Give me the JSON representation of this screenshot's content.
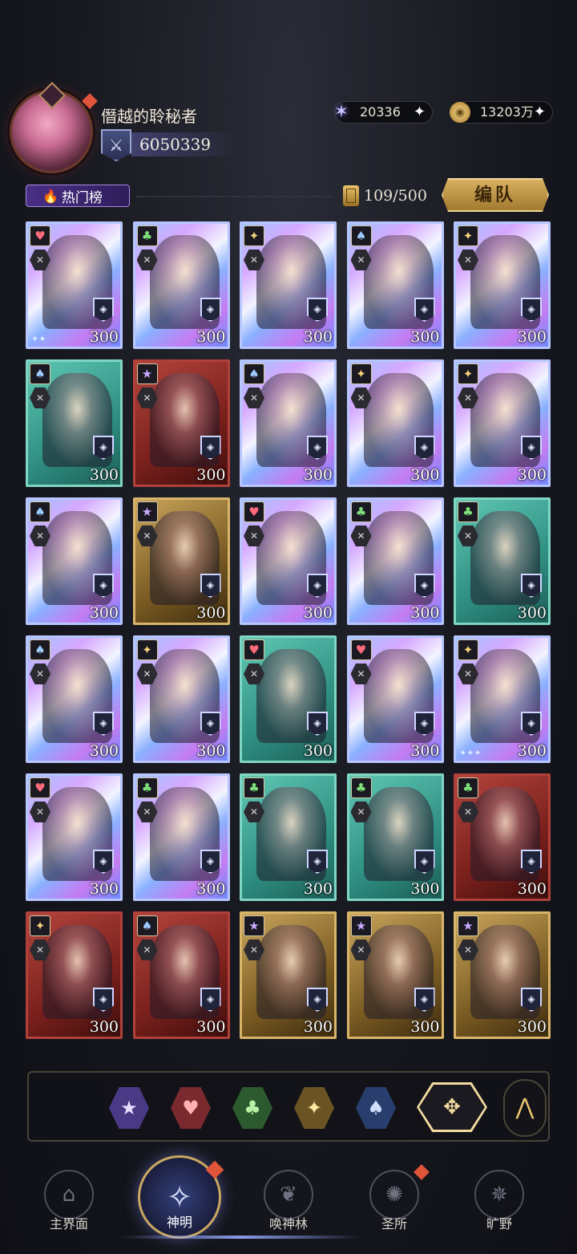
{
  "player": {
    "name": "僭越的聆秘者",
    "power": "6050339"
  },
  "currencies": {
    "star": "20336",
    "gold": "13203万"
  },
  "toolbar": {
    "hot_list_label": "热门榜",
    "capacity": "109/500",
    "formation_label": "编队"
  },
  "cards": [
    {
      "frame": "holo",
      "suit": "heart",
      "level": "300",
      "stars": "✦✦"
    },
    {
      "frame": "holo",
      "suit": "club",
      "level": "300",
      "stars": ""
    },
    {
      "frame": "holo",
      "suit": "spark",
      "level": "300",
      "stars": ""
    },
    {
      "frame": "holo",
      "suit": "spade",
      "level": "300",
      "stars": ""
    },
    {
      "frame": "holo",
      "suit": "spark",
      "level": "300",
      "stars": ""
    },
    {
      "frame": "teal",
      "suit": "spade",
      "level": "300",
      "stars": ""
    },
    {
      "frame": "red",
      "suit": "star",
      "level": "300",
      "stars": ""
    },
    {
      "frame": "holo",
      "suit": "spade",
      "level": "300",
      "stars": ""
    },
    {
      "frame": "holo",
      "suit": "spark",
      "level": "300",
      "stars": ""
    },
    {
      "frame": "holo",
      "suit": "spark",
      "level": "300",
      "stars": ""
    },
    {
      "frame": "holo",
      "suit": "spade",
      "level": "300",
      "stars": ""
    },
    {
      "frame": "gold",
      "suit": "star",
      "level": "300",
      "stars": ""
    },
    {
      "frame": "holo",
      "suit": "heart",
      "level": "300",
      "stars": ""
    },
    {
      "frame": "holo",
      "suit": "club",
      "level": "300",
      "stars": ""
    },
    {
      "frame": "teal",
      "suit": "club",
      "level": "300",
      "stars": ""
    },
    {
      "frame": "holo",
      "suit": "spade",
      "level": "300",
      "stars": ""
    },
    {
      "frame": "holo",
      "suit": "spark",
      "level": "300",
      "stars": ""
    },
    {
      "frame": "teal",
      "suit": "heart",
      "level": "300",
      "stars": ""
    },
    {
      "frame": "holo",
      "suit": "heart",
      "level": "300",
      "stars": ""
    },
    {
      "frame": "holo",
      "suit": "spark",
      "level": "300",
      "stars": "✦✦✦"
    },
    {
      "frame": "holo",
      "suit": "heart",
      "level": "300",
      "stars": ""
    },
    {
      "frame": "holo",
      "suit": "club",
      "level": "300",
      "stars": ""
    },
    {
      "frame": "teal",
      "suit": "club",
      "level": "300",
      "stars": ""
    },
    {
      "frame": "teal",
      "suit": "club",
      "level": "300",
      "stars": ""
    },
    {
      "frame": "red",
      "suit": "club",
      "level": "300",
      "stars": ""
    },
    {
      "frame": "red",
      "suit": "spark",
      "level": "300",
      "stars": ""
    },
    {
      "frame": "red",
      "suit": "spade",
      "level": "300",
      "stars": ""
    },
    {
      "frame": "gold",
      "suit": "star",
      "level": "300",
      "stars": ""
    },
    {
      "frame": "gold",
      "suit": "star",
      "level": "300",
      "stars": ""
    },
    {
      "frame": "gold",
      "suit": "star",
      "level": "300",
      "stars": ""
    }
  ],
  "suit_icons": {
    "heart": "♥",
    "club": "♣",
    "spark": "✦",
    "spade": "♠",
    "star": "★"
  },
  "filters": [
    "star",
    "heart",
    "club",
    "spark",
    "spade",
    "all"
  ],
  "nav": {
    "home": "主界面",
    "gods": "神明",
    "summon": "唤神林",
    "sanctuary": "圣所",
    "wilds": "旷野"
  }
}
